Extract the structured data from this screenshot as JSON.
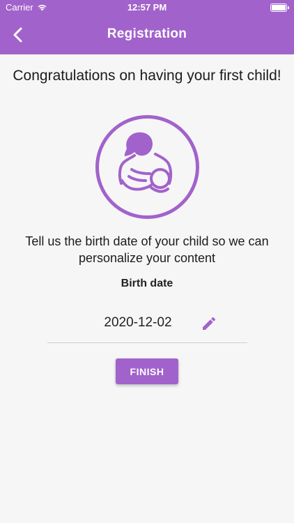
{
  "status_bar": {
    "carrier": "Carrier",
    "time": "12:57 PM",
    "wifi_icon": "wifi-icon",
    "battery_icon": "battery-icon"
  },
  "nav": {
    "title": "Registration",
    "back_icon": "chevron-left-icon"
  },
  "main": {
    "headline": "Congratulations on having your first child!",
    "illustration_icon": "mother-breastfeeding-icon",
    "subtext": "Tell us the birth date of your child so we can personalize your content",
    "birth_date_label": "Birth date",
    "birth_date_value": "2020-12-02",
    "edit_icon": "pencil-icon",
    "finish_label": "FINISH"
  },
  "colors": {
    "accent": "#a262cb",
    "background": "#f6f6f6"
  }
}
